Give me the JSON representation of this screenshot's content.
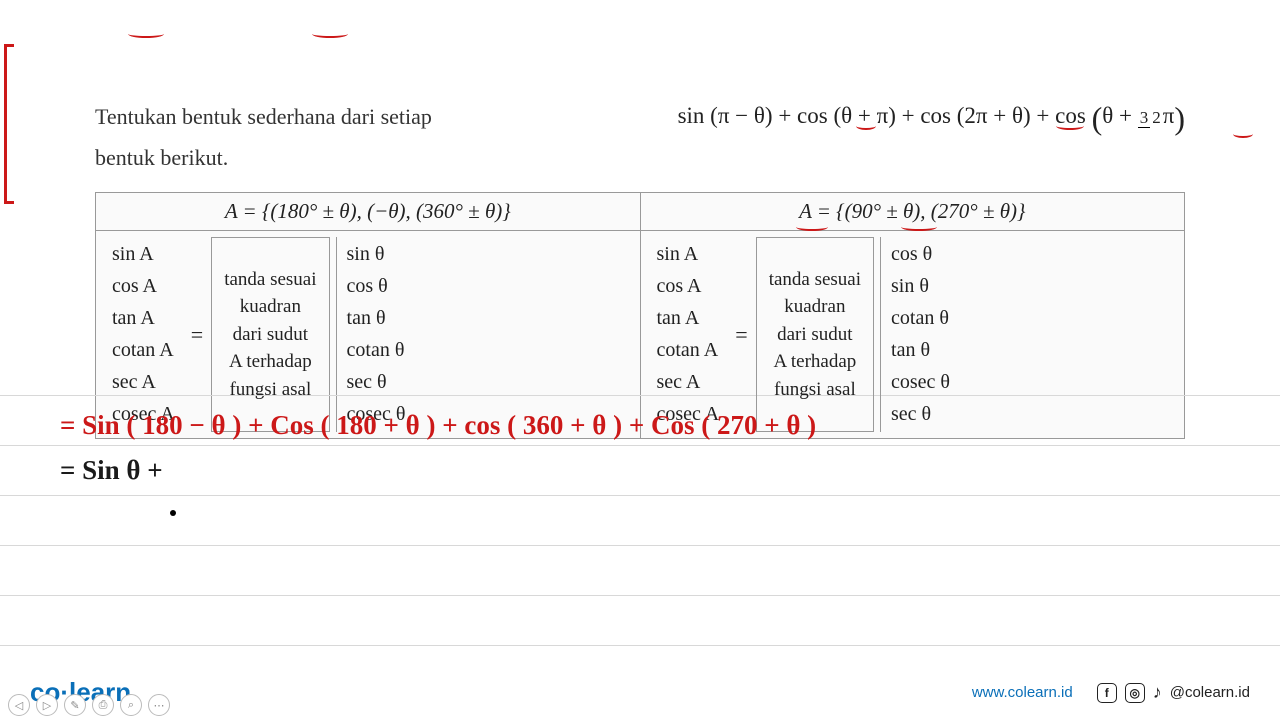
{
  "instruction": {
    "line1": "Tentukan bentuk sederhana dari setiap",
    "line2": "bentuk berikut."
  },
  "expression": {
    "part1": "sin (π − θ) + cos (θ + π) +   cos (2π + θ) + cos ",
    "frac_num": "3",
    "frac_den": "2",
    "pi": "π",
    "theta_plus": "θ + "
  },
  "table": {
    "left": {
      "header": "A = {(180° ± θ), (−θ), (360° ± θ)}",
      "funcs": [
        "sin A",
        "cos A",
        "tan A",
        "cotan A",
        "sec A",
        "cosec A"
      ],
      "sign_box": [
        "tanda sesuai",
        "kuadran",
        "dari sudut",
        "A terhadap",
        "fungsi asal"
      ],
      "results": [
        "sin θ",
        "cos θ",
        "tan θ",
        "cotan θ",
        "sec θ",
        "cosec θ"
      ]
    },
    "right": {
      "header": "A = {(90° ± θ), (270° ± θ)}",
      "funcs": [
        "sin A",
        "cos A",
        "tan A",
        "cotan A",
        "sec A",
        "cosec A"
      ],
      "sign_box": [
        "tanda sesuai",
        "kuadran",
        "dari sudut",
        "A terhadap",
        "fungsi asal"
      ],
      "results": [
        "cos θ",
        "sin θ",
        "cotan θ",
        "tan θ",
        "cosec θ",
        "sec θ"
      ]
    },
    "equals": "="
  },
  "handwriting": {
    "line1": "=   Sin ( 180 − θ ) +  Cos ( 180 + θ )  +  cos  ( 360 + θ )  +   Cos ( 270 + θ )",
    "line2": "=    Sin θ   +"
  },
  "footer": {
    "logo_co": "co",
    "logo_learn": "learn",
    "url": "www.colearn.id",
    "handle": "@colearn.id"
  },
  "controls": [
    "◁",
    "▷",
    "✎",
    "⎙",
    "⌕",
    "⋯"
  ]
}
